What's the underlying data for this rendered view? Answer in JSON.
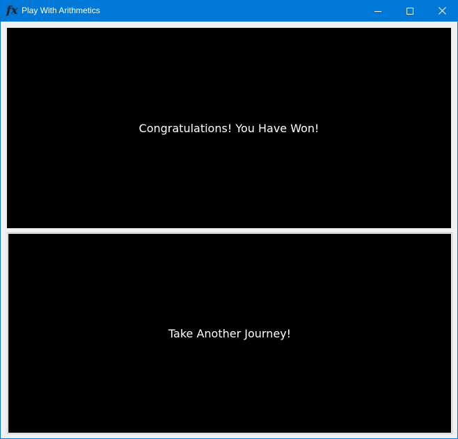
{
  "window": {
    "title": "Play With Arithmetics",
    "icon": "fx-icon",
    "icon_text": "fx",
    "accent_color": "#0078d7"
  },
  "controls": {
    "minimize": "minimize-icon",
    "maximize": "maximize-icon",
    "close": "close-icon"
  },
  "main": {
    "result_message": "Congratulations! You Have Won!",
    "restart_label": "Take Another Journey!"
  }
}
